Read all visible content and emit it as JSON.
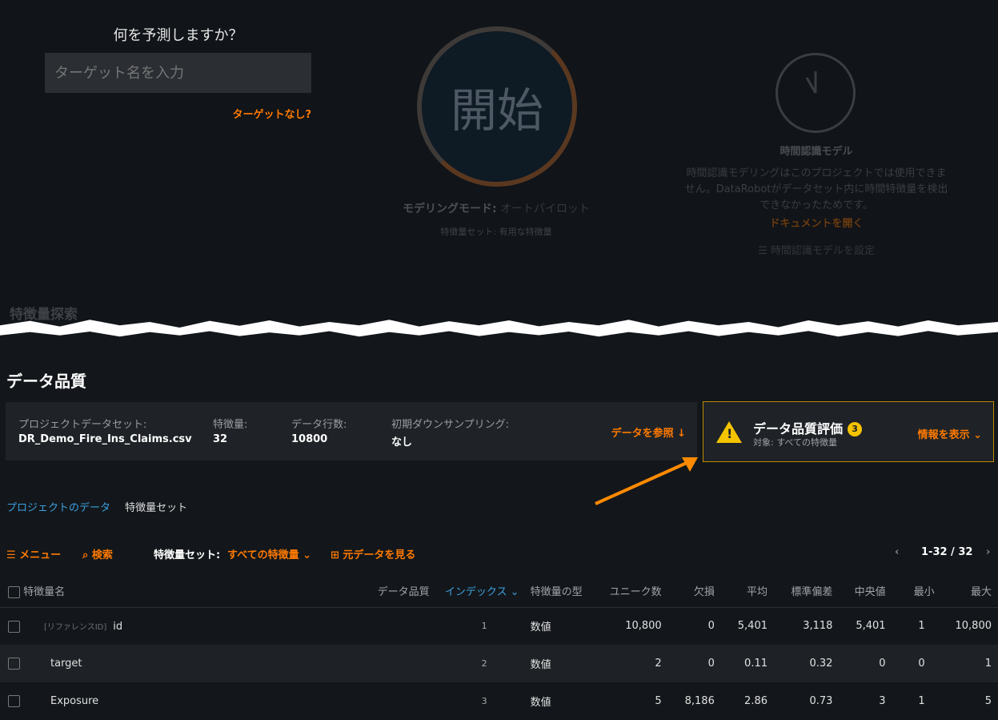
{
  "start": {
    "question": "何を予測しますか？",
    "target_placeholder": "ターゲット名を入力",
    "no_target": "ターゲットなし?",
    "start_button": "開始",
    "mode_label": "モデリングモード:",
    "mode_value": "オートパイロット",
    "feature_set": "特徴量セット: 有用な特徴量"
  },
  "time_model": {
    "title": "時間認識モデル",
    "description": "時間認識モデリングはこのプロジェクトでは使用できません。DataRobotがデータセット内に時間特徴量を検出できなかったためです。",
    "doc_link": "ドキュメントを開く",
    "setup": "☰ 時間認識モデルを設定"
  },
  "feature_explore": "特徴量探索",
  "data_quality": {
    "heading": "データ品質",
    "info": [
      {
        "label": "プロジェクトデータセット:",
        "value": "DR_Demo_Fire_Ins_Claims.csv"
      },
      {
        "label": "特徴量:",
        "value": "32"
      },
      {
        "label": "データ行数:",
        "value": "10800"
      },
      {
        "label": "初期ダウンサンプリング:",
        "value": "なし"
      }
    ],
    "browse": "データを参照 ↓",
    "assessment_title": "データ品質評価",
    "assessment_count": "3",
    "assessment_sub": "対象: すべての特徴量",
    "show_info": "情報を表示 ⌄"
  },
  "tabs": [
    "プロジェクトのデータ",
    "特徴量セット"
  ],
  "toolbar": {
    "menu": "☰ メニュー",
    "search": "検索",
    "feature_set_label": "特徴量セット:",
    "feature_set_value": "すべての特徴量 ⌄",
    "raw_data": "元データを見る",
    "pagination": "1-32 / 32"
  },
  "table": {
    "headers": [
      "特徴量名",
      "データ品質",
      "インデックス ⌄",
      "特徴量の型",
      "ユニーク数",
      "欠損",
      "平均",
      "標準偏差",
      "中央値",
      "最小",
      "最大"
    ],
    "rows": [
      {
        "prefix": "[リファレンスID]",
        "name": "id",
        "index": "1",
        "type": "数値",
        "unique": "10,800",
        "missing": "0",
        "mean": "5,401",
        "std": "3,118",
        "median": "5,401",
        "min": "1",
        "max": "10,800"
      },
      {
        "prefix": "",
        "name": "target",
        "index": "2",
        "type": "数値",
        "unique": "2",
        "missing": "0",
        "mean": "0.11",
        "std": "0.32",
        "median": "0",
        "min": "0",
        "max": "1"
      },
      {
        "prefix": "",
        "name": "Exposure",
        "index": "3",
        "type": "数値",
        "unique": "5",
        "missing": "8,186",
        "mean": "2.86",
        "std": "0.73",
        "median": "3",
        "min": "1",
        "max": "5"
      }
    ]
  }
}
